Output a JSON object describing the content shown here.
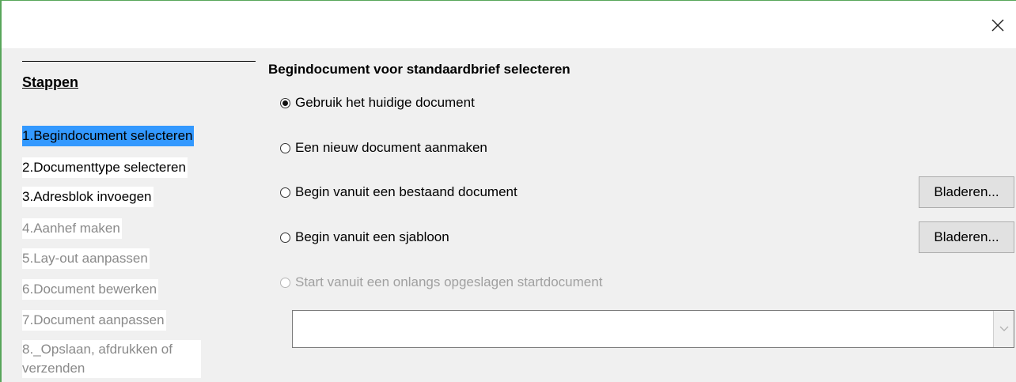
{
  "dialog": {
    "close_icon": "close-icon"
  },
  "sidebar": {
    "heading": "Stappen",
    "steps": [
      {
        "num": "1.",
        "label": "Begindocument selecteren",
        "state": "selected"
      },
      {
        "num": "2.",
        "label": "Documenttype selecteren",
        "state": "enabled"
      },
      {
        "num": "3.",
        "label": "Adresblok invoegen",
        "state": "enabled"
      },
      {
        "num": "4.",
        "label": "Aanhef maken",
        "state": "disabled"
      },
      {
        "num": "5.",
        "label": "Lay-out aanpassen",
        "state": "disabled"
      },
      {
        "num": "6.",
        "label": "Document bewerken",
        "state": "disabled"
      },
      {
        "num": "7.",
        "label": "Document aanpassen",
        "state": "disabled"
      },
      {
        "num": "8.",
        "label": "_Opslaan, afdrukken of verzenden",
        "state": "disabled"
      }
    ]
  },
  "main": {
    "title": "Begindocument voor standaardbrief selecteren",
    "options": [
      {
        "label": "Gebruik het huidige document",
        "checked": true,
        "enabled": true
      },
      {
        "label": "Een nieuw document aanmaken",
        "checked": false,
        "enabled": true
      },
      {
        "label": "Begin vanuit een bestaand document",
        "checked": false,
        "enabled": true
      },
      {
        "label": "Begin vanuit een sjabloon",
        "checked": false,
        "enabled": true
      },
      {
        "label": "Start vanuit een onlangs opgeslagen startdocument",
        "checked": false,
        "enabled": false
      }
    ],
    "browse_existing_label": "Bladeren...",
    "browse_template_label": "Bladeren...",
    "recent_docs_value": ""
  },
  "colors": {
    "selection": "#3399ff",
    "disabled_text": "#8a8a8a",
    "accent_border": "#58a65a"
  }
}
